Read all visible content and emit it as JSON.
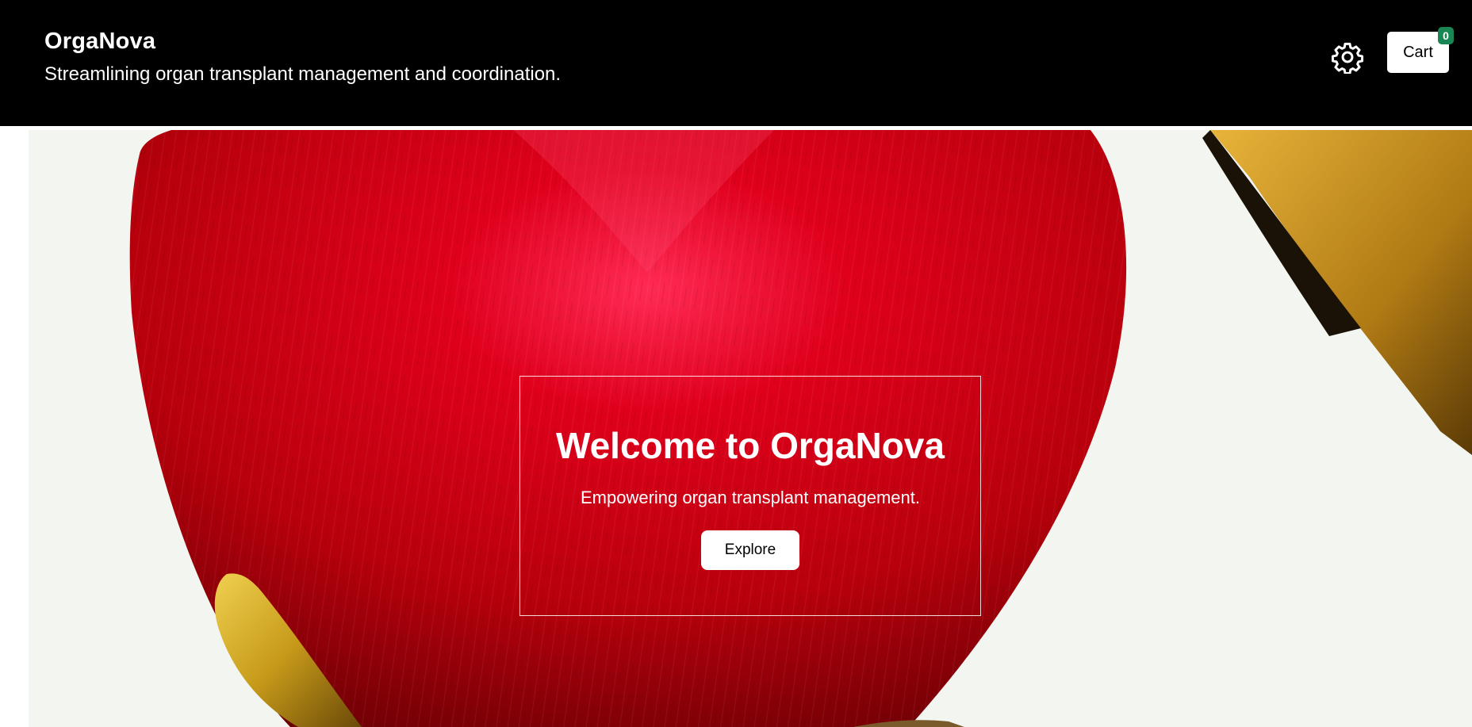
{
  "header": {
    "brand": "OrgaNova",
    "tagline": "Streamlining organ transplant management and coordination.",
    "settings_icon": "gear-icon",
    "cart_label": "Cart",
    "cart_count": "0"
  },
  "hero": {
    "image_subject": "red textured heart held by golden hands",
    "title": "Welcome to OrgaNova",
    "subtitle": "Empowering organ transplant management.",
    "cta_label": "Explore"
  },
  "colors": {
    "header_bg": "#000000",
    "badge": "#198754",
    "heart_red": "#c8000f",
    "gold": "#c79a1a"
  }
}
